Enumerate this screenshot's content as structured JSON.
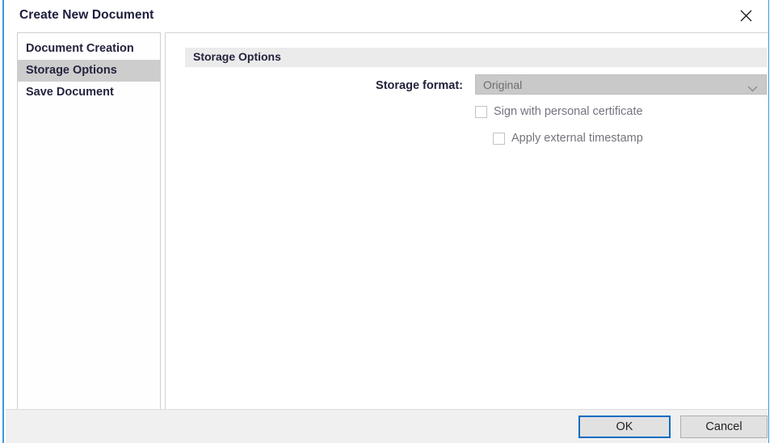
{
  "window": {
    "title": "Create New Document",
    "close_icon": "close-icon",
    "border_color": "#3c99de"
  },
  "sidebar": {
    "items": [
      {
        "label": "Document Creation",
        "selected": false
      },
      {
        "label": "Storage Options",
        "selected": true
      },
      {
        "label": "Save Document",
        "selected": false
      }
    ],
    "selected_background": "#cdcdcd"
  },
  "content": {
    "section_header": "Storage Options",
    "section_header_background": "#ebebeb",
    "form": {
      "storage_format": {
        "label": "Storage format:",
        "value": "Original",
        "disabled": true,
        "arrow_icon": "chevron-down-icon",
        "background": "#c9c9c9",
        "text_color": "#6e6e73"
      },
      "checkboxes": [
        {
          "label": "Sign with personal certificate",
          "checked": false,
          "disabled": true,
          "indent": 0
        },
        {
          "label": "Apply external timestamp",
          "checked": false,
          "disabled": true,
          "indent": 22
        }
      ]
    }
  },
  "footer": {
    "ok_label": "OK",
    "cancel_label": "Cancel",
    "focus_color": "#0a6cc4"
  }
}
